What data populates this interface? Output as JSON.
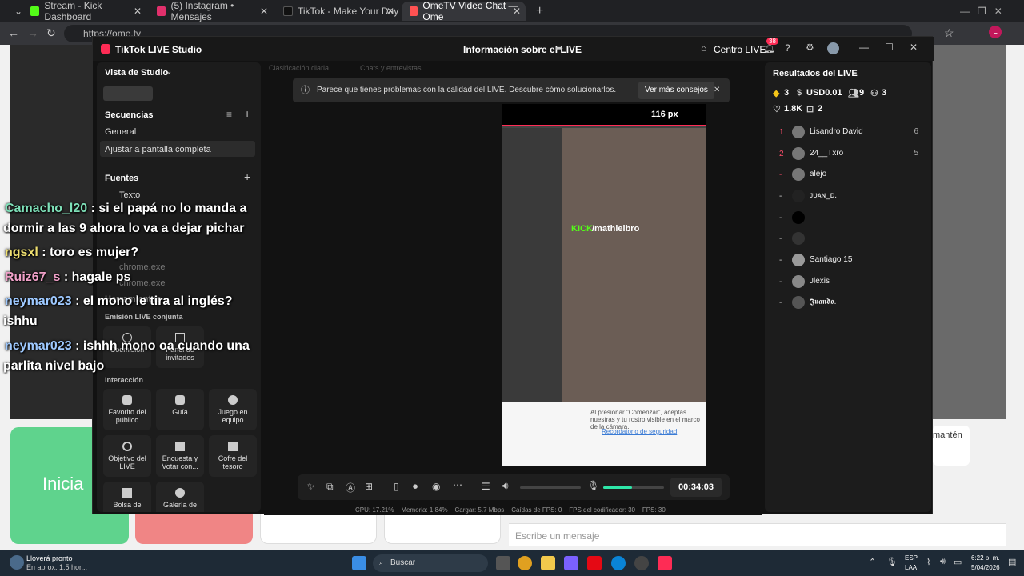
{
  "browser": {
    "tabs": [
      {
        "label": "Stream - Kick Dashboard",
        "color": "#53fc18"
      },
      {
        "label": "(5) Instagram • Mensajes",
        "color": "#e1306c"
      },
      {
        "label": "TikTok - Make Your Day",
        "color": "#111111"
      },
      {
        "label": "OmeTV Video Chat — Ome",
        "color": "#ff5252"
      }
    ],
    "url": "https://ome.tv"
  },
  "overlay_chat": [
    {
      "user": "Camacho_l20",
      "text": ": si el papá no lo manda a"
    },
    {
      "user": "",
      "text": "dormir a las 9 ahora lo va a dejar pichar"
    },
    {
      "user": "ngsxl",
      "text": ": toro es mujer?"
    },
    {
      "user": "Ruiz67_s",
      "text": ": hagale ps"
    },
    {
      "user": "neymar023",
      "text": ": el mono le tira al inglés?"
    },
    {
      "user": "",
      "text": "ishhu"
    },
    {
      "user": "neymar023",
      "text": ": ishhh mono oa cuando una"
    },
    {
      "user": "",
      "text": "parlita nivel bajo"
    }
  ],
  "page": {
    "start_label": "Inicia",
    "keep_label": "mantén",
    "message_placeholder": "Escribe un mensaje"
  },
  "studio": {
    "app_title": "TikTok LIVE Studio",
    "live_info": "Información sobre el LIVE",
    "centro_live": "Centro LIVE",
    "notif_count": "38",
    "vista": "Vista de Studio",
    "secuencias": "Secuencias",
    "seq_items": [
      "General",
      "Ajustar a pantalla completa"
    ],
    "fuentes": "Fuentes",
    "source_items": [
      "Texto",
      "chrome.exe",
      "chrome.exe"
    ],
    "herramientas": "Herramientas",
    "emision_conjunta": "Emisión LIVE conjunta",
    "cohost_tiles": [
      "Coemisión",
      "Panel de invitados"
    ],
    "interaccion": "Interacción",
    "interaction_tiles": [
      "Favorito del público",
      "Guía",
      "Juego en equipo",
      "Objetivo del LIVE",
      "Encuesta y Votar con...",
      "Cofre del tesoro",
      "Bolsa de",
      "Galería de"
    ],
    "top_tabs": [
      "Clasificación diaria",
      "Chats y entrevistas"
    ],
    "banner_text": "Parece que tienes problemas con la calidad del LIVE. Descubre cómo solucionarlos.",
    "banner_button": "Ver más consejos",
    "px_label": "116 px",
    "stream_tag": "/mathielbro",
    "stream_tag_prefix": "KICK",
    "preview_text": "Al presionar \"Comenzar\", aceptas nuestras y tu rostro visible en el marco de la cámara.",
    "preview_link": "Recordatorio de seguridad",
    "timer": "00:34:03",
    "status": {
      "cpu": "CPU: 17.21%",
      "mem": "Memoria: 1.84%",
      "load": "Cargar: 5.7 Mbps",
      "fps_drop": "Caídas de FPS: 0",
      "enc_fps": "FPS del codificador: 30",
      "fps": "FPS: 30"
    },
    "results": {
      "title": "Resultados del LIVE",
      "diamonds": "3",
      "usd": "USD0.01",
      "viewers": "9",
      "new_followers": "3",
      "likes": "1.8K",
      "gifts": "2",
      "ranking": [
        {
          "rank": "1",
          "name": "Lisandro David",
          "score": "6"
        },
        {
          "rank": "2",
          "name": "24__Txro",
          "score": "5"
        },
        {
          "rank": "-",
          "name": "alejo",
          "score": ""
        },
        {
          "rank": "-",
          "name": "ᴊᴜᴀɴ_ᴅ.",
          "score": ""
        },
        {
          "rank": "-",
          "name": "",
          "score": ""
        },
        {
          "rank": "-",
          "name": "",
          "score": ""
        },
        {
          "rank": "-",
          "name": "Santiago 15",
          "score": ""
        },
        {
          "rank": "-",
          "name": "Jlexis",
          "score": ""
        },
        {
          "rank": "-",
          "name": "𝕵𝖚𝖆𝖓𝖉𝖔.",
          "score": ""
        }
      ]
    }
  },
  "taskbar": {
    "weather_title": "Lloverá pronto",
    "weather_sub": "En aprox. 1.5 hor...",
    "search": "Buscar",
    "lang1": "ESP",
    "lang2": "LAA",
    "time": "6:22 p. m.",
    "date": "5/04/2026"
  }
}
